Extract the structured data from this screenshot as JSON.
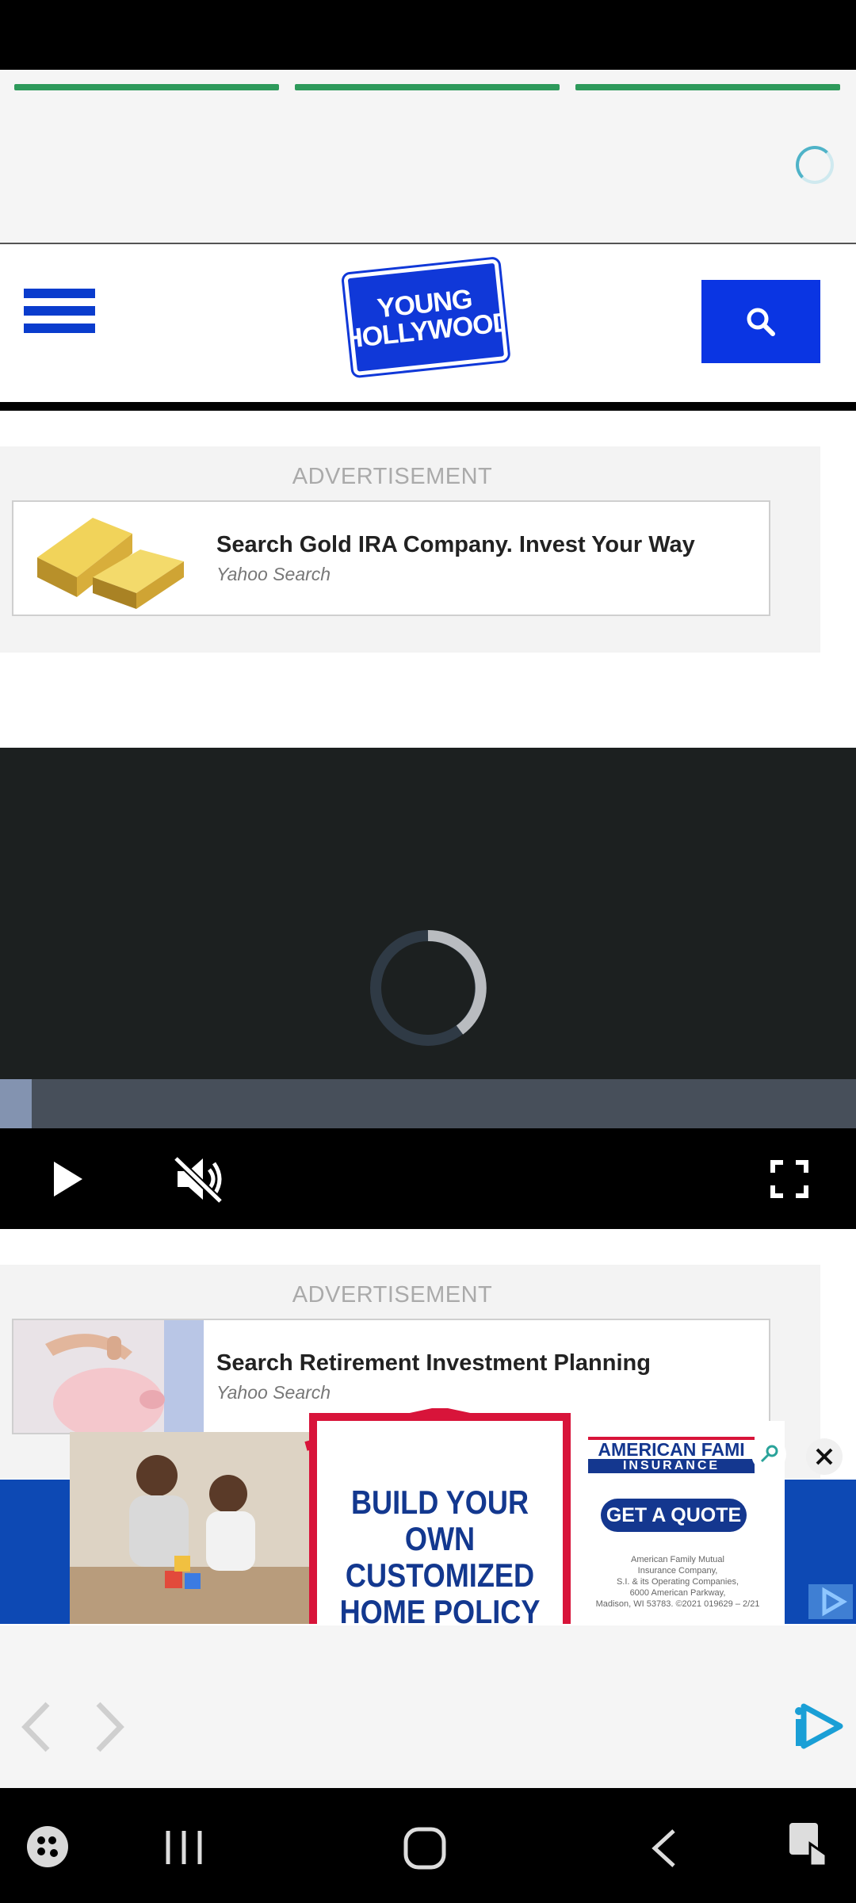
{
  "site": {
    "logo_line1": "YOUNG",
    "logo_line2": "HOLLYWOOD",
    "brand_color": "#0a35e3"
  },
  "stories": {
    "segment_count": 3,
    "segment_color": "#2e9a5b"
  },
  "ads": [
    {
      "label": "ADVERTISEMENT",
      "title": "Search Gold IRA Company. Invest Your Way",
      "source": "Yahoo Search",
      "thumb": "gold-bars-image"
    },
    {
      "label": "ADVERTISEMENT",
      "title": "Search Retirement Investment Planning",
      "source": "Yahoo Search",
      "thumb": "piggy-bank-image"
    }
  ],
  "video": {
    "progress_fraction": 0.037,
    "controls": [
      "play-icon",
      "muted-icon",
      "fullscreen-icon"
    ]
  },
  "banner": {
    "headline_lines": [
      "BUILD YOUR OWN",
      "CUSTOMIZED",
      "HOME POLICY"
    ],
    "brand_line1": "AMERICAN FAMI",
    "brand_line2": "INSURANCE",
    "cta": "GET A QUOTE",
    "fine_print": [
      "American Family Mutual",
      "Insurance Company,",
      "S.I. & its Operating Companies,",
      "6000 American Parkway,",
      "Madison, WI 53783. ©2021 019629 – 2/21"
    ]
  },
  "system_nav": [
    "game-launcher-icon",
    "recent-apps-icon",
    "home-icon",
    "back-icon",
    "accessibility-icon"
  ]
}
